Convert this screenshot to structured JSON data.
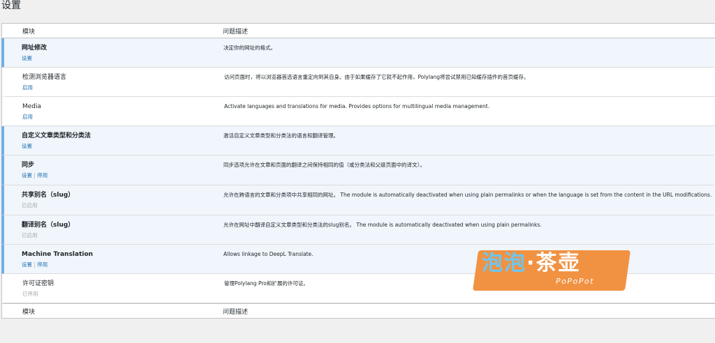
{
  "page_title": "设置",
  "table": {
    "col_module": "模块",
    "col_description": "问题描述"
  },
  "modules": [
    {
      "name": "网址修改",
      "status": "active",
      "actions": [
        "设置"
      ],
      "description": "决定你的网址的格式。"
    },
    {
      "name": "检测浏览器语言",
      "status": "inactive",
      "actions": [
        "启用"
      ],
      "description": "访问页面时，将以浏览器首选语言重定向到其自身。由于如果缓存了它就不起作用，Polylang将尝试禁用已知缓存插件的首页缓存。"
    },
    {
      "name": "Media",
      "status": "inactive",
      "actions": [
        "启用"
      ],
      "description": "Activate languages and translations for media. Provides options for multilingual media management."
    },
    {
      "name": "自定义文章类型和分类法",
      "status": "active",
      "actions": [
        "设置"
      ],
      "description": "激活自定义文章类型和分类法的语言和翻译管理。"
    },
    {
      "name": "同步",
      "status": "active",
      "actions": [
        "设置",
        "停用"
      ],
      "description": "同步选项允许在文章和页面的翻译之间保持相同的值（或分类法和父级页面中的译文）。"
    },
    {
      "name": "共享别名（slug）",
      "status": "active",
      "actions": [],
      "muted_status": "已启用",
      "description": "允许在跨语言的文章和分类项中共享相同的网址。 The module is automatically deactivated when using plain permalinks or when the language is set from the content in the URL modifications."
    },
    {
      "name": "翻译别名（slug）",
      "status": "active",
      "actions": [],
      "muted_status": "已启用",
      "description": "允许在网址中翻译自定义文章类型和分类法的slug别名。 The module is automatically deactivated when using plain permalinks."
    },
    {
      "name": "Machine Translation",
      "status": "active",
      "actions": [
        "设置",
        "停用"
      ],
      "description": "Allows linkage to DeepL Translate."
    },
    {
      "name": "许可证密钥",
      "status": "inactive",
      "actions": [],
      "muted_status": "已停用",
      "description": "管理Polylang Pro和扩展的许可证。"
    }
  ],
  "watermark": {
    "main_a": "泡泡",
    "dot": "·",
    "main_b": "茶壶",
    "sub": "PoPoPot"
  },
  "colors": {
    "active_border": "#72aee6",
    "active_bg": "#f0f6fc",
    "link": "#2271b1",
    "watermark_bg": "#f08c38"
  }
}
